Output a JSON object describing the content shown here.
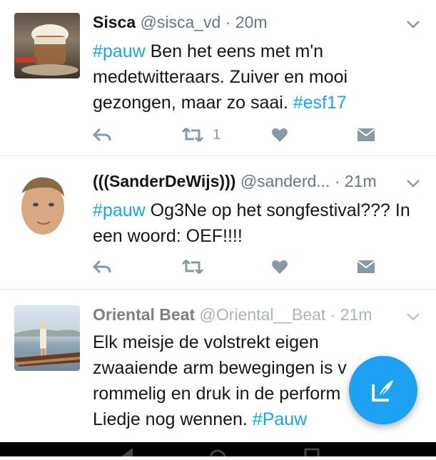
{
  "tweets": [
    {
      "name": "Sisca",
      "handle": "@sisca_vd",
      "time": "· 20m",
      "text_parts": [
        "#pauw",
        " Ben het eens met m'n medetwitteraars. Zuiver en mooi gezongen,  maar zo saai. ",
        "#esf17"
      ],
      "retweet_count": "1",
      "avatar_icon": "coffee-photo"
    },
    {
      "name": "(((SanderDeWijs)))",
      "handle": "@sanderd...",
      "time": "· 21m",
      "text_parts": [
        "#pauw",
        " Og3Ne op het songfestival??? In een woord: OEF!!!!"
      ],
      "retweet_count": "",
      "avatar_icon": "man-portrait-photo"
    },
    {
      "name": "Oriental Beat",
      "handle": "@Oriental__Beat",
      "time": "· 21m",
      "text_lines": [
        "Elk meisje de volstrekt eigen",
        "zwaaiende arm bewegingen is v",
        "rommelig en druk in de perform",
        "Liedje nog wennen. "
      ],
      "tag_end": "#Pauw",
      "avatar_icon": "boat-woman-photo"
    }
  ],
  "colors": {
    "accent": "#1da1f2",
    "text": "#14171a",
    "secondary": "#657786",
    "icon": "#8899a6"
  }
}
